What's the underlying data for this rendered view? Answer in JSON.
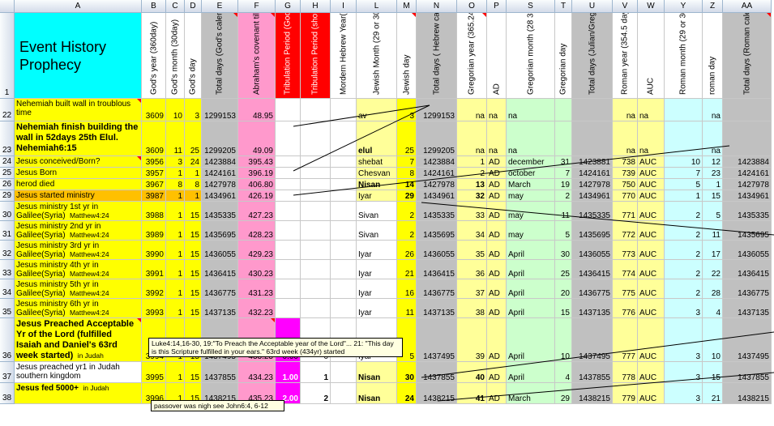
{
  "sheet": {
    "columns": [
      "A",
      "B",
      "C",
      "D",
      "E",
      "F",
      "G",
      "H",
      "I",
      "L",
      "M",
      "N",
      "O",
      "P",
      "S",
      "T",
      "U",
      "V",
      "W",
      "Y",
      "Z",
      "AA"
    ],
    "header_row": {
      "row_num": "1",
      "title": "Event History Prophecy",
      "B": "God's year (360day)",
      "C": "God's month (30day)",
      "D": "God's day",
      "E": "Total days (God's calendar)",
      "F": "Abraham's covenant till 1st temple & Daniel's 70week",
      "G": "Tribulation Period (God's 24hr day)",
      "H": "Tribulation Period (shortened days)",
      "I": "Mordern Hebrew Year(365.2468)",
      "L": "Jewish Month (29 or 30days)",
      "M": "Jewish day",
      "N": "Total days ( Hebrew calendar)",
      "O": "Gregorian year (365.24219 day)",
      "P": "AD",
      "S": "Gregorian month (28 31day)",
      "T": "Gregorian day",
      "U": "Total days (Julian/Gregorian calendar)",
      "V": "Roman year (354.5 day)",
      "W": "AUC",
      "Y": "Roman month (29 or 30 day)",
      "Z": "roman day",
      "AA": "Total days (Roman calendar)"
    },
    "rows": [
      {
        "n": "22",
        "A": "Nehemiah built wall in troublous time",
        "B": "3609",
        "C": "10",
        "D": "3",
        "E": "1299153",
        "F": "48.95",
        "L": "av",
        "M": "3",
        "N": "1299153",
        "O": "na",
        "P": "na",
        "S": "na",
        "V": "na",
        "W": "na",
        "Z": "na"
      },
      {
        "n": "23",
        "A": "Nehemiah finish building the wall in 52days 25th Elul. Nehemiah6:15",
        "B": "3609",
        "C": "11",
        "D": "25",
        "E": "1299205",
        "F": "49.09",
        "L": "elul",
        "M": "25",
        "N": "1299205",
        "O": "na",
        "P": "na",
        "S": "na",
        "V": "na",
        "W": "na",
        "Z": "na"
      },
      {
        "n": "24",
        "A": "Jesus conceived/Born?",
        "B": "3956",
        "C": "3",
        "D": "24",
        "E": "1423884",
        "F": "395.43",
        "L": "shebat",
        "M": "7",
        "N": "1423884",
        "O": "1",
        "P": "AD",
        "S": "december",
        "T": "31",
        "U": "1423881",
        "V": "738",
        "W": "AUC",
        "Y": "10",
        "Z": "12",
        "AA": "1423884"
      },
      {
        "n": "25",
        "A": "Jesus Born",
        "B": "3957",
        "C": "1",
        "D": "1",
        "E": "1424161",
        "F": "396.19",
        "L": "Chesvan",
        "M": "8",
        "N": "1424161",
        "O": "2",
        "P": "AD",
        "S": "october",
        "T": "7",
        "U": "1424161",
        "V": "739",
        "W": "AUC",
        "Y": "7",
        "Z": "23",
        "AA": "1424161"
      },
      {
        "n": "26",
        "A": "herod died",
        "B": "3967",
        "C": "8",
        "D": "8",
        "E": "1427978",
        "F": "406.80",
        "L": "Nisan",
        "M": "14",
        "N": "1427978",
        "O": "13",
        "P": "AD",
        "S": "March",
        "T": "19",
        "U": "1427978",
        "V": "750",
        "W": "AUC",
        "Y": "5",
        "Z": "1",
        "AA": "1427978"
      },
      {
        "n": "29",
        "A": "Jesus started ministry",
        "B": "3987",
        "C": "1",
        "D": "1",
        "E": "1434961",
        "F": "426.19",
        "L": "Iyar",
        "M": "29",
        "N": "1434961",
        "O": "32",
        "P": "AD",
        "S": "may",
        "T": "2",
        "U": "1434961",
        "V": "770",
        "W": "AUC",
        "Y": "1",
        "Z": "15",
        "AA": "1434961"
      },
      {
        "n": "30",
        "A": "Jesus ministry 1st yr in Galilee(Syria)",
        "A2": "Matthew4:24",
        "B": "3988",
        "C": "1",
        "D": "15",
        "E": "1435335",
        "F": "427.23",
        "L": "Sivan",
        "M": "2",
        "N": "1435335",
        "O": "33",
        "P": "AD",
        "S": "may",
        "T": "11",
        "U": "1435335",
        "V": "771",
        "W": "AUC",
        "Y": "2",
        "Z": "5",
        "AA": "1435335"
      },
      {
        "n": "31",
        "A": "Jesus ministry 2nd yr in Galilee(Syria)",
        "A2": "Matthew4:24",
        "B": "3989",
        "C": "1",
        "D": "15",
        "E": "1435695",
        "F": "428.23",
        "L": "Sivan",
        "M": "2",
        "N": "1435695",
        "O": "34",
        "P": "AD",
        "S": "may",
        "T": "5",
        "U": "1435695",
        "V": "772",
        "W": "AUC",
        "Y": "2",
        "Z": "11",
        "AA": "1435695"
      },
      {
        "n": "32",
        "A": "Jesus ministry 3rd yr in Galilee(Syria)",
        "A2": "Matthew4:24",
        "B": "3990",
        "C": "1",
        "D": "15",
        "E": "1436055",
        "F": "429.23",
        "L": "Iyar",
        "M": "26",
        "N": "1436055",
        "O": "35",
        "P": "AD",
        "S": "April",
        "T": "30",
        "U": "1436055",
        "V": "773",
        "W": "AUC",
        "Y": "2",
        "Z": "17",
        "AA": "1436055"
      },
      {
        "n": "33",
        "A": "Jesus ministry 4th yr in Galilee(Syria)",
        "A2": "Matthew4:24",
        "B": "3991",
        "C": "1",
        "D": "15",
        "E": "1436415",
        "F": "430.23",
        "L": "Iyar",
        "M": "21",
        "N": "1436415",
        "O": "36",
        "P": "AD",
        "S": "April",
        "T": "25",
        "U": "1436415",
        "V": "774",
        "W": "AUC",
        "Y": "2",
        "Z": "22",
        "AA": "1436415"
      },
      {
        "n": "34",
        "A": "Jesus ministry 5th yr in Galilee(Syria)",
        "A2": "Matthew4:24",
        "B": "3992",
        "C": "1",
        "D": "15",
        "E": "1436775",
        "F": "431.23",
        "L": "Iyar",
        "M": "16",
        "N": "1436775",
        "O": "37",
        "P": "AD",
        "S": "April",
        "T": "20",
        "U": "1436775",
        "V": "775",
        "W": "AUC",
        "Y": "2",
        "Z": "28",
        "AA": "1436775"
      },
      {
        "n": "35",
        "A": "Jesus ministry 6th yr in Galilee(Syria)",
        "A2": "Matthew4:24",
        "B": "3993",
        "C": "1",
        "D": "15",
        "E": "1437135",
        "F": "432.23",
        "L": "Iyar",
        "M": "11",
        "N": "1437135",
        "O": "38",
        "P": "AD",
        "S": "April",
        "T": "15",
        "U": "1437135",
        "V": "776",
        "W": "AUC",
        "Y": "3",
        "Z": "4",
        "AA": "1437135"
      },
      {
        "n": "36",
        "A": "Jesus Preached Acceptable Yr of the Lord (fulfilled Isaiah and Daniel's 63rd week started)",
        "A2": "in Judah",
        "B": "3994",
        "C": "1",
        "D": "15",
        "E": "1437495",
        "F": "433.23",
        "G": "0.00",
        "H": "0",
        "L": "Iyar",
        "M": "5",
        "N": "1437495",
        "O": "39",
        "P": "AD",
        "S": "April",
        "T": "10",
        "U": "1437495",
        "V": "777",
        "W": "AUC",
        "Y": "3",
        "Z": "10",
        "AA": "1437495"
      },
      {
        "n": "37",
        "A": "Jesus preached yr1 in Judah southern kingdom",
        "B": "3995",
        "C": "1",
        "D": "15",
        "E": "1437855",
        "F": "434.23",
        "G": "1.00",
        "H": "1",
        "L": "Nisan",
        "M": "30",
        "N": "1437855",
        "O": "40",
        "P": "AD",
        "S": "April",
        "T": "4",
        "U": "1437855",
        "V": "778",
        "W": "AUC",
        "Y": "3",
        "Z": "15",
        "AA": "1437855"
      },
      {
        "n": "38",
        "A": "Jesus fed 5000+",
        "A2": "in Judah",
        "B": "3996",
        "C": "1",
        "D": "15",
        "E": "1438215",
        "F": "435.23",
        "G": "2.00",
        "H": "2",
        "L": "Nisan",
        "M": "24",
        "N": "1438215",
        "O": "41",
        "P": "AD",
        "S": "March",
        "T": "29",
        "U": "1438215",
        "V": "779",
        "W": "AUC",
        "Y": "3",
        "Z": "21",
        "AA": "1438215"
      }
    ],
    "comments": {
      "luke": "Luke4:14,16-30, 19:\"To Preach the Acceptable year of the Lord\"... 21: \"This day is this Scripture fulfilled in your ears.\" 63rd week (434yr) started",
      "passover": "passover was nigh see John6:4, 6-12"
    }
  },
  "colors": {
    "yellow": "#ffff00",
    "cyan": "#00ffff",
    "pink": "#ff99cc",
    "red": "#ff0000",
    "magenta": "#ff00ff",
    "orange": "#ffc000",
    "gray": "#c0c0c0",
    "lightyellow": "#ffff99",
    "lightgreen": "#ccffcc",
    "lightcyan": "#ccffff"
  }
}
